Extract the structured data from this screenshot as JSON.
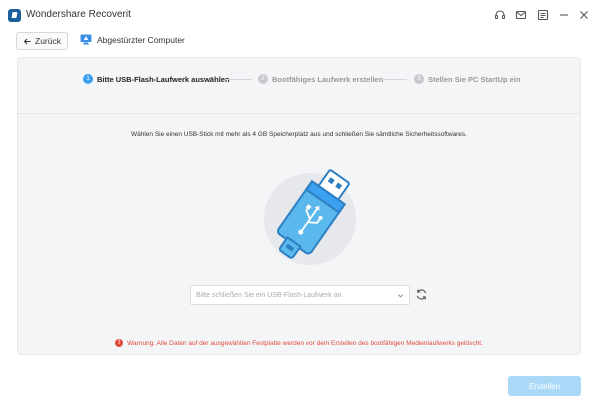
{
  "window": {
    "app_title": "Wondershare Recoverit",
    "controls": [
      "headset-icon",
      "mail-icon",
      "menu-icon",
      "minimize-icon",
      "close-icon"
    ]
  },
  "nav": {
    "back_label": "Zurück",
    "breadcrumb_label": "Abgestürzter Computer"
  },
  "steps": [
    {
      "number": "1",
      "label": "Bitte USB-Flash-Laufwerk auswählen",
      "state": "active"
    },
    {
      "number": "2",
      "label": "Bootfähiges Laufwerk erstellen",
      "state": "inactive"
    },
    {
      "number": "3",
      "label": "Stellen Sie PC StartUp ein",
      "state": "inactive"
    }
  ],
  "main": {
    "instruction": "Wählen Sie einen USB-Stick mit mehr als 4 GB Speicherplatz aus und schließen Sie sämtliche Sicherheitssoftwares.",
    "drive_select_placeholder": "Bitte schließen Sie ein USB-Flash-Laufwerk an.",
    "warning": "Warnung: Alle Daten auf der ausgewählten Festplatte werden vor dem Erstellen des bootfähigen Medienlaufwerks gelöscht."
  },
  "footer": {
    "create_label": "Erstellen"
  },
  "colors": {
    "accent": "#3aa0ef",
    "warning": "#e04b3c",
    "create_button_disabled": "#a9d9f7",
    "usb_body": "#5bb8ec"
  }
}
